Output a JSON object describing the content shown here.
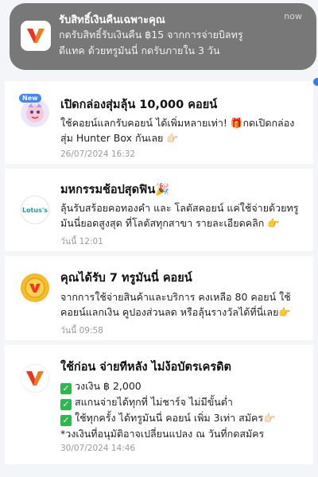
{
  "notification": {
    "title": "รับสิทธิ์เงินคืนเฉพาะคุณ",
    "time": "now",
    "body_lines": [
      "กดรับสิทธิ์รับเงินคืน ฿15 จากการจ่ายบิลทรู",
      "ดีแทค ด้วยทรูมันนี่ กดรับภายใน 3 วัน"
    ],
    "app_icon": "truemoney-icon"
  },
  "messages": [
    {
      "title": "เปิดกล่องสุ่มลุ้น 10,000 คอยน์",
      "badge": "New",
      "icon": "hunter-box-icon",
      "body_lines": [
        "ใช้คอยน์แลกรับคอยน์ ได้เพิ่มหลายเท่า! 🎁กดเปิดกล่อง",
        "สุ่ม Hunter Box กันเลย 👉🏻"
      ],
      "time": "26/07/2024 16:32"
    },
    {
      "title": "มหกรรมช้อปสุดฟิน🎉",
      "logo_text": "Lotus's",
      "icon": "lotuss-logo-icon",
      "body_lines": [
        "ลุ้นรับสร้อยคอทองคำ และ โลตัสคอยน์ แค่ใช้จ่ายด้วยทรู",
        "มันนี่ยอดสูงสุด ที่โลตัสทุกสาขา รายละเอียดคลิก 👉"
      ],
      "time": "วันนี้ 12:01"
    },
    {
      "title": "คุณได้รับ 7 ทรูมันนี่ คอยน์",
      "icon": "truemoney-coin-icon",
      "body_lines": [
        "จากการใช้จ่ายสินค้าและบริการ คงเหลือ 80 คอยน์ ใช้",
        "คอยน์แลกเงิน คูปองส่วนลด หรือลุ้นรางวัลได้ที่นี่เลย👉"
      ],
      "time": "วันนี้ 09:58"
    },
    {
      "title": "ใช้ก่อน จ่ายทีหลัง ไม่ง้อบัตรเครดิต",
      "icon": "truemoney-logo-icon",
      "check_lines": [
        "วงเงิน ฿ 2,000",
        "สแกนจ่ายได้ทุกที่ ไม่ชาร์จ ไม่มีขั้นต่ำ",
        "ใช้ทุกครั้ง ได้ทรูมันนี่ คอยน์ เพิ่ม 3เท่า สมัคร👉🏻"
      ],
      "note": "*วงเงินที่อนุมัติอาจเปลี่ยนแปลง ณ วันที่กดสมัคร",
      "time": "30/07/2024 14:46"
    }
  ]
}
